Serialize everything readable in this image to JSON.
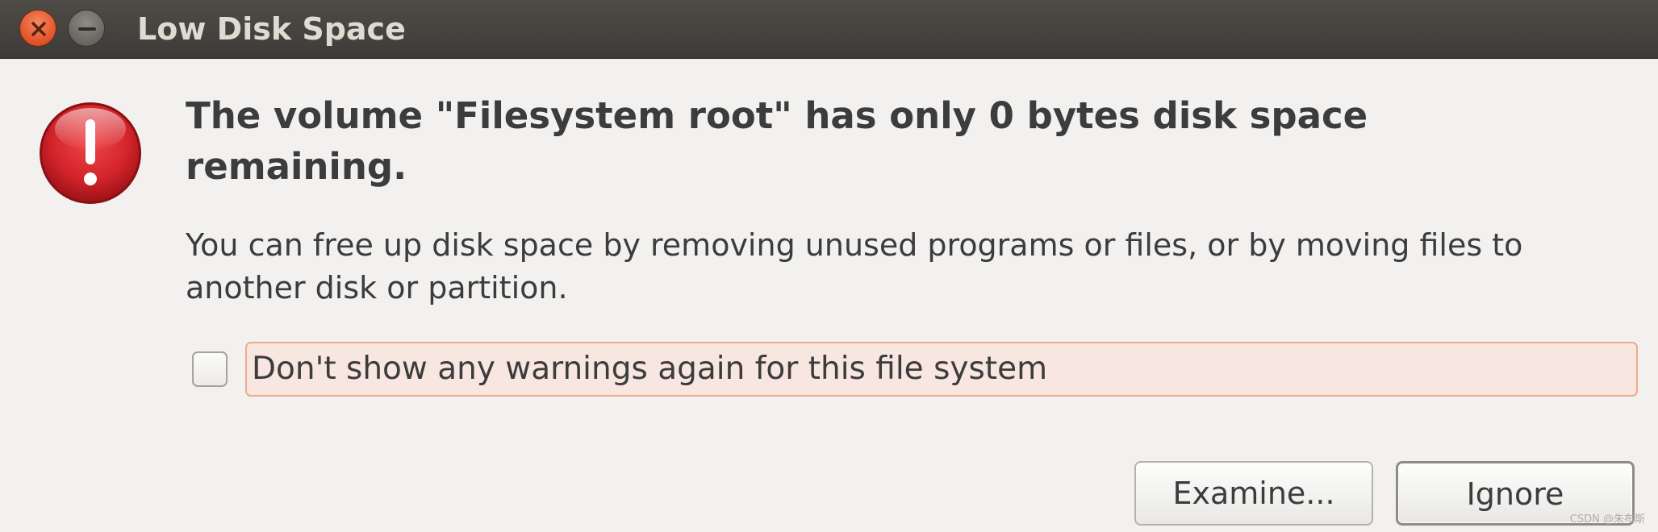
{
  "window": {
    "title": "Low Disk Space",
    "close_icon": "close-icon",
    "minimize_icon": "minimize-icon"
  },
  "dialog": {
    "icon": "error-icon",
    "heading": "The volume \"Filesystem root\" has only 0 bytes disk space remaining.",
    "body": "You can free up disk space by removing unused programs or files, or by moving files to another disk or partition.",
    "checkbox": {
      "label": "Don't show any warnings again for this file system",
      "checked": false
    },
    "buttons": {
      "examine_label": "Examine...",
      "ignore_label": "Ignore"
    }
  },
  "watermark": "CSDN @朱布斯",
  "colors": {
    "titlebar": "#3d3b38",
    "title_text": "#dfdbd2",
    "close_button": "#e4582d",
    "error_icon": "#d6262a",
    "focus_border": "#f0a98a"
  }
}
